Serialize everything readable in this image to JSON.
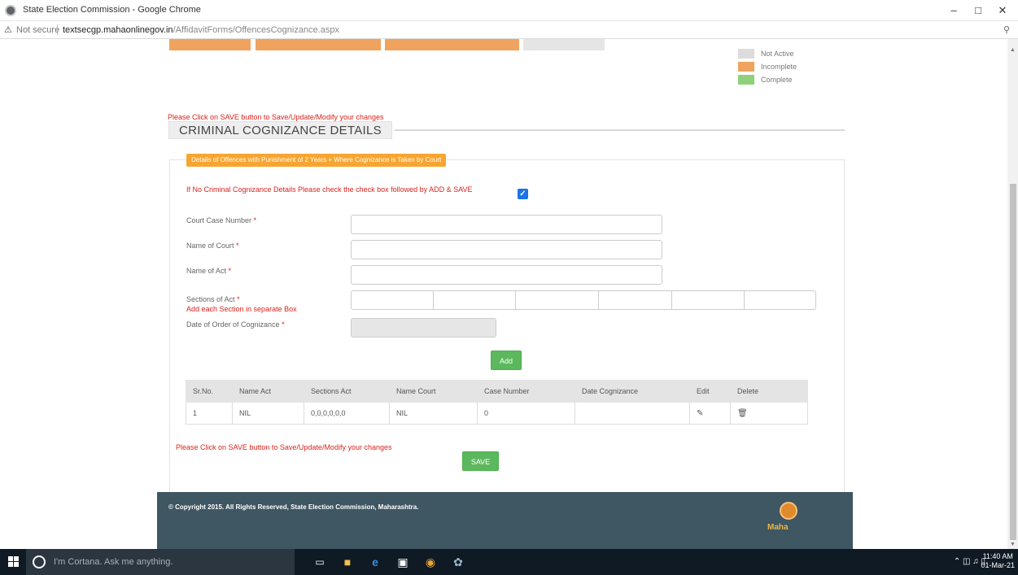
{
  "window": {
    "title": "State Election Commission - Google Chrome",
    "minimize": "–",
    "restore": "□",
    "close": "✕"
  },
  "address": {
    "security_text": "Not secure",
    "host": "textsecgp.mahaonlinegov.in",
    "path": "/AffidavitForms/OffencesCognizance.aspx"
  },
  "legend": [
    {
      "label": "Not Active",
      "color": "#dcdcdc"
    },
    {
      "label": "Incomplete",
      "color": "#f0a35e"
    },
    {
      "label": "Complete",
      "color": "#8fd17a"
    }
  ],
  "notice_top": "Please Click on SAVE button to Save/Update/Modify your changes",
  "section_title": "CRIMINAL COGNIZANCE DETAILS",
  "panel_heading": "Details of Offences with Punishment of 2 Years + Where Cognizance is Taken by Court",
  "form": {
    "no_details_label": "If No Criminal Cognizance Details Please check the check box followed by ADD & SAVE",
    "no_details_checked": true,
    "court_case_number_label": "Court Case Number",
    "name_of_court_label": "Name of Court",
    "name_of_act_label": "Name of Act",
    "sections_of_act_label": "Sections of Act",
    "sections_hint": "Add each Section in separate Box",
    "date_of_order_label": "Date of Order of Cognizance",
    "required_marker": "*"
  },
  "add_button": "Add",
  "table": {
    "headers": [
      "Sr.No.",
      "Name Act",
      "Sections Act",
      "Name Court",
      "Case Number",
      "Date Cognizance",
      "Edit",
      "Delete"
    ],
    "rows": [
      [
        "1",
        "NIL",
        "0,0,0,0,0,0",
        "NIL",
        "0",
        "",
        "",
        ""
      ]
    ]
  },
  "notice_bottom": "Please Click on SAVE button to Save/Update/Modify your changes",
  "save_button": "SAVE",
  "footer": {
    "copyright": "© Copyright 2015. All Rights Reserved, State Election Commission, Maharashtra.",
    "logo_text": "Maha"
  },
  "taskbar": {
    "cortana_placeholder": "I'm Cortana. Ask me anything.",
    "time": "11:40 AM",
    "date": "01-Mar-21"
  }
}
